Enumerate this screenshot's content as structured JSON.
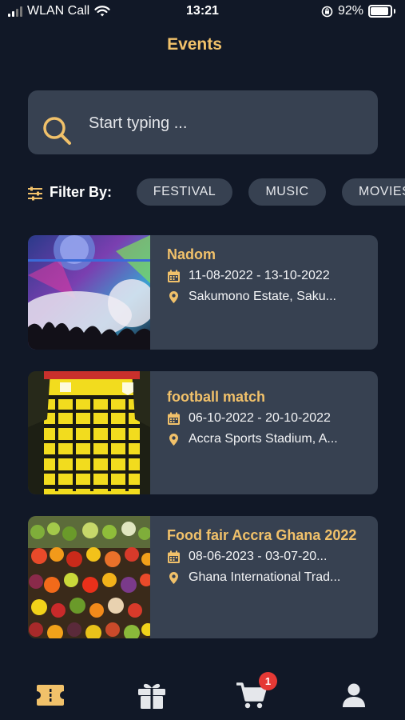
{
  "status_bar": {
    "carrier": "WLAN Call",
    "time": "13:21",
    "battery": "92%"
  },
  "header": {
    "title": "Events"
  },
  "search": {
    "placeholder": "Start typing ..."
  },
  "filter": {
    "label": "Filter By:",
    "chips": [
      "FESTIVAL",
      "MUSIC",
      "MOVIES"
    ]
  },
  "events": [
    {
      "title": "Nadom",
      "dates": "11-08-2022 - 13-10-2022",
      "location": "Sakumono Estate, Saku..."
    },
    {
      "title": "football match",
      "dates": "06-10-2022 - 20-10-2022",
      "location": "Accra Sports Stadium, A..."
    },
    {
      "title": "Food fair Accra Ghana 2022",
      "dates": "08-06-2023 - 03-07-20...",
      "location": "Ghana International Trad..."
    }
  ],
  "tabbar": {
    "tabs": [
      "ticket-icon",
      "gift-icon",
      "cart-icon",
      "profile-icon"
    ],
    "cart_badge": "1"
  },
  "colors": {
    "background": "#111827",
    "card": "#374151",
    "accent": "#f1c16a",
    "badge": "#e53935"
  }
}
